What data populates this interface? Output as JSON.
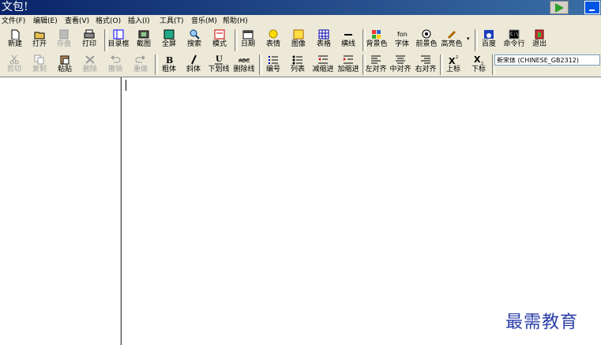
{
  "window": {
    "title": "文包!"
  },
  "menu": [
    "文件(F)",
    "编辑(E)",
    "查看(V)",
    "格式(O)",
    "插入(I)",
    "工具(T)",
    "音乐(M)",
    "帮助(H)"
  ],
  "toolbar1": [
    {
      "label": "新建"
    },
    {
      "label": "打开"
    },
    {
      "label": "存盘",
      "disabled": true
    },
    {
      "label": "打印"
    },
    {
      "label": "目录框"
    },
    {
      "label": "截图"
    },
    {
      "label": "全屏"
    },
    {
      "label": "搜索"
    },
    {
      "label": "模式"
    },
    {
      "label": "日期"
    },
    {
      "label": "表情"
    },
    {
      "label": "图像"
    },
    {
      "label": "表格"
    },
    {
      "label": "横线"
    },
    {
      "label": "背景色"
    },
    {
      "label": "字体"
    },
    {
      "label": "前景色"
    },
    {
      "label": "高亮色"
    },
    {
      "label": "百度"
    },
    {
      "label": "命令行"
    },
    {
      "label": "退出"
    }
  ],
  "toolbar2": [
    {
      "label": "剪切",
      "disabled": true
    },
    {
      "label": "复制",
      "disabled": true
    },
    {
      "label": "粘贴"
    },
    {
      "label": "删除",
      "disabled": true
    },
    {
      "label": "撤销",
      "disabled": true
    },
    {
      "label": "重做",
      "disabled": true
    },
    {
      "label": "粗体"
    },
    {
      "label": "斜体"
    },
    {
      "label": "下划线"
    },
    {
      "label": "删除线"
    },
    {
      "label": "编号"
    },
    {
      "label": "列表"
    },
    {
      "label": "减缩进"
    },
    {
      "label": "加缩进"
    },
    {
      "label": "左对齐"
    },
    {
      "label": "中对齐"
    },
    {
      "label": "右对齐"
    },
    {
      "label": "上标"
    },
    {
      "label": "下标"
    }
  ],
  "font_select": {
    "value": "新宋体 (CHINESE_GB2312)"
  },
  "watermark": "最需教育"
}
